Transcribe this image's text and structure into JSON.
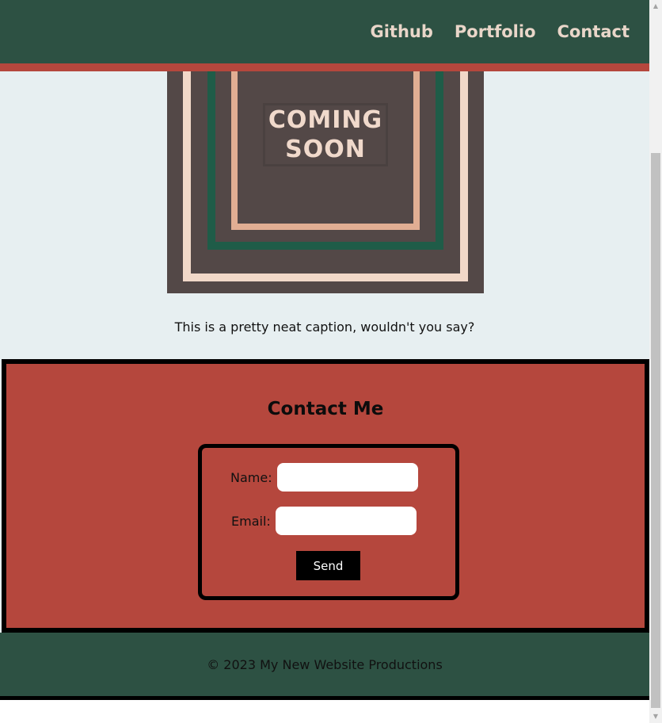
{
  "nav": {
    "items": [
      {
        "label": "Github"
      },
      {
        "label": "Portfolio"
      },
      {
        "label": "Contact"
      }
    ]
  },
  "hero": {
    "image_text": "COMING\nSOON",
    "caption": "This is a pretty neat caption, wouldn't you say?"
  },
  "contact": {
    "title": "Contact Me",
    "name_label": "Name:",
    "name_value": "",
    "email_label": "Email:",
    "email_value": "",
    "send_label": "Send"
  },
  "footer": {
    "text": "© 2023 My New Website Productions"
  },
  "colors": {
    "header_bg": "#2d5143",
    "accent_red": "#b5473d",
    "page_bg": "#e7eff1",
    "nav_text": "#e9d6c9"
  },
  "icons": {
    "scroll_up": "triangle-up-icon",
    "scroll_down": "triangle-down-icon"
  }
}
